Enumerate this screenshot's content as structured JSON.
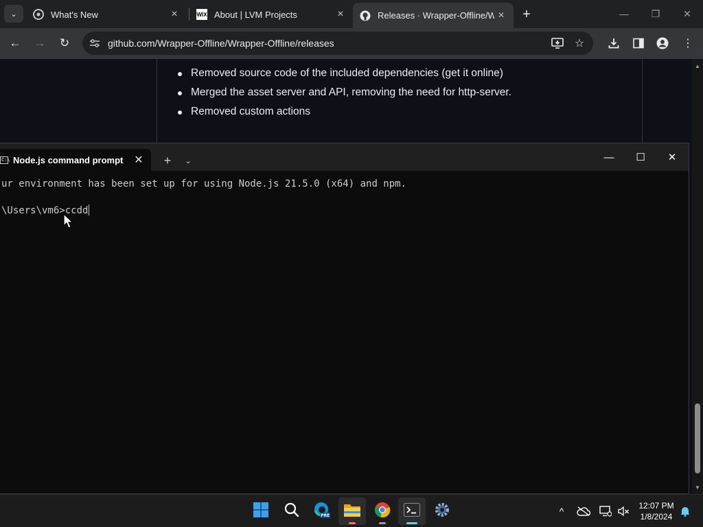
{
  "browser": {
    "tabs": [
      {
        "title": "What's New",
        "favicon": "chrome-icon",
        "active": false
      },
      {
        "title": "About | LVM Projects",
        "favicon": "wix-icon",
        "favicon_text": "WIX",
        "active": false
      },
      {
        "title": "Releases · Wrapper-Offline/Wrapper-Offline",
        "favicon": "github-icon",
        "active": true
      }
    ],
    "url": "github.com/Wrapper-Offline/Wrapper-Offline/releases"
  },
  "page": {
    "release_notes": [
      "Removed source code of the included dependencies (get it online)",
      "Merged the asset server and API, removing the need for http-server.",
      "Removed custom actions"
    ]
  },
  "terminal": {
    "tab_title": "Node.js command prompt",
    "tab_icon_text": "C:\\",
    "lines": [
      "ur environment has been set up for using Node.js 21.5.0 (x64) and npm.",
      "\\Users\\vm6>ccdd"
    ]
  },
  "taskbar": {
    "apps": [
      "windows-start-icon",
      "search-icon",
      "edge-beta-icon",
      "file-explorer-icon",
      "chrome-icon",
      "terminal-icon",
      "settings-icon"
    ],
    "time": "12:07 PM",
    "date": "1/8/2024"
  },
  "colors": {
    "chrome_bg": "#202124",
    "chrome_toolbar": "#35363a",
    "github_bg": "#0d1117",
    "terminal_bg": "#0c0c0c",
    "taskbar_bg": "#1c1c1c",
    "accent": "#60cdff"
  }
}
